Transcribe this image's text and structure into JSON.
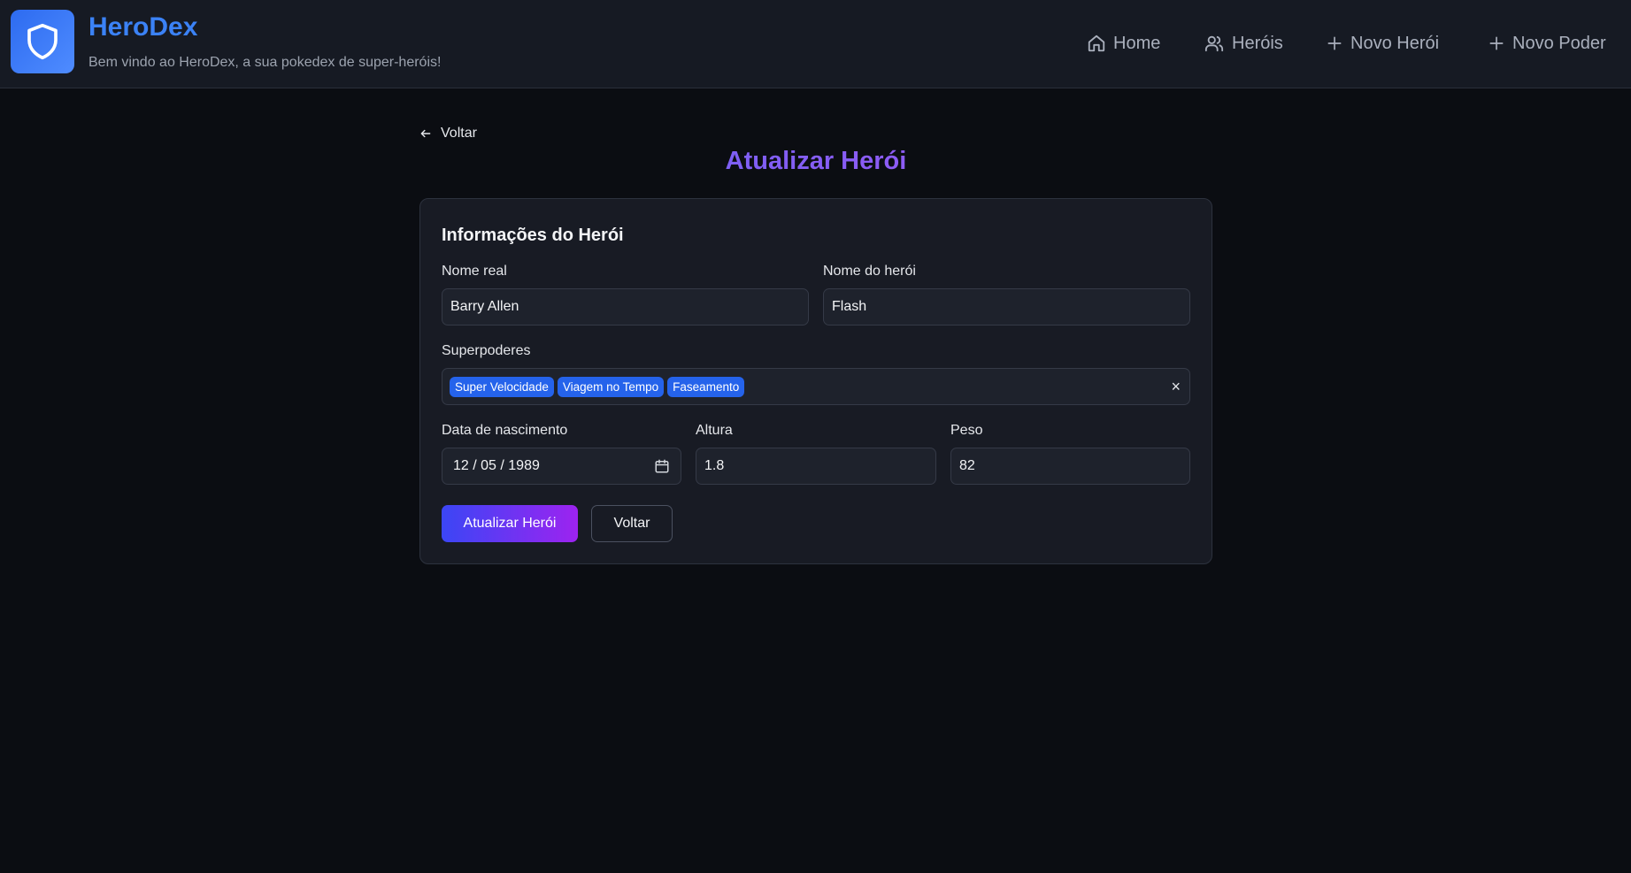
{
  "header": {
    "brand_title": "HeroDex",
    "brand_subtitle": "Bem vindo ao HeroDex, a sua pokedex de super-heróis!",
    "logo_icon": "shield-icon",
    "nav": [
      {
        "label": "Home",
        "icon": "home-icon"
      },
      {
        "label": "Heróis",
        "icon": "users-icon"
      },
      {
        "label": "Novo Herói",
        "icon": "plus-icon"
      },
      {
        "label": "Novo Poder",
        "icon": "plus-icon"
      }
    ]
  },
  "main": {
    "back_label": "Voltar",
    "page_title": "Atualizar Herói"
  },
  "form": {
    "section_title": "Informações do Herói",
    "real_name": {
      "label": "Nome real",
      "value": "Barry Allen"
    },
    "hero_name": {
      "label": "Nome do herói",
      "value": "Flash"
    },
    "powers": {
      "label": "Superpoderes",
      "selected": [
        "Super Velocidade",
        "Viagem no Tempo",
        "Faseamento"
      ],
      "clear_symbol": "×"
    },
    "birth_date": {
      "label": "Data de nascimento",
      "value": "12 / 05 / 1989"
    },
    "height": {
      "label": "Altura",
      "value": "1.8"
    },
    "weight": {
      "label": "Peso",
      "value": "82"
    },
    "submit_label": "Atualizar Herói",
    "cancel_label": "Voltar"
  },
  "colors": {
    "background": "#0b0d12",
    "header": "#161a23",
    "brand": "#3b82f6",
    "chip": "#2563eb",
    "title_gradient_start": "#6366f1",
    "title_gradient_end": "#a855f7"
  }
}
